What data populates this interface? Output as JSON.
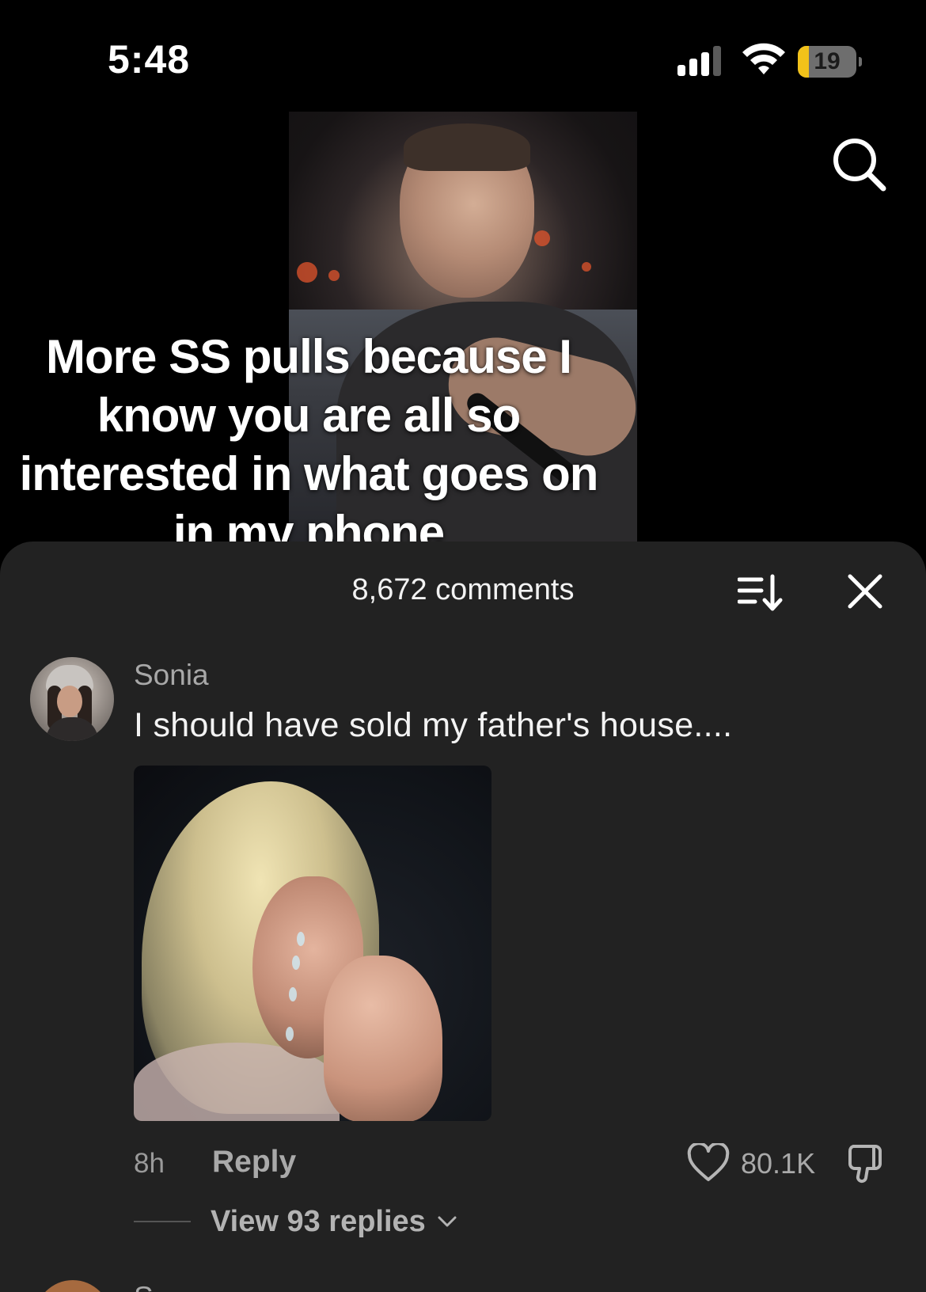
{
  "status_bar": {
    "time": "5:48",
    "battery_level": "19",
    "battery_fraction": 0.19
  },
  "video": {
    "caption": "More SS pulls because I know you are all so interested in what goes on in my phone"
  },
  "comments_sheet": {
    "title": "8,672 comments",
    "comments": [
      {
        "username": "Sonia",
        "text": "I should have sold my father's house....",
        "time": "8h",
        "reply_label": "Reply",
        "likes": "80.1K",
        "view_replies_label": "View 93 replies"
      }
    ],
    "next_comment_partial_username": "S"
  },
  "colors": {
    "background": "#000000",
    "sheet": "#222222",
    "primary_text": "#f3f3f3",
    "secondary_text": "#a8a8a8",
    "battery_accent": "#f2c21a"
  },
  "icons": [
    "cellular-signal-icon",
    "wifi-icon",
    "battery-icon",
    "search-icon",
    "sort-icon",
    "close-icon",
    "heart-icon",
    "dislike-icon",
    "chevron-down-icon"
  ]
}
